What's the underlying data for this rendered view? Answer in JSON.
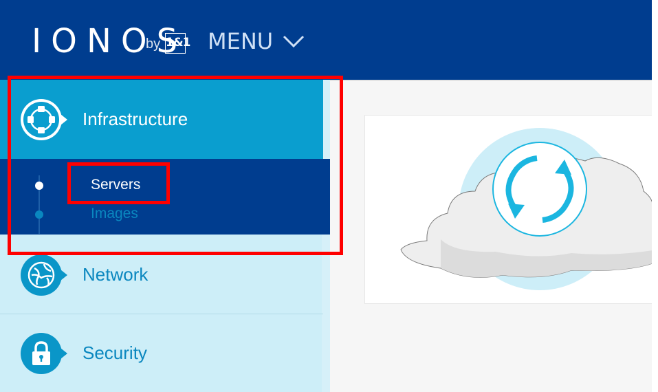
{
  "header": {
    "logo_text": "IONOS",
    "logo_by": "by",
    "logo_brand": "1&1",
    "menu_label": "MENU"
  },
  "sidebar": {
    "items": [
      {
        "label": "Infrastructure",
        "icon": "infrastructure-icon",
        "active": true
      },
      {
        "label": "Network",
        "icon": "globe-icon",
        "active": false
      },
      {
        "label": "Security",
        "icon": "lock-icon",
        "active": false
      }
    ],
    "subitems": [
      {
        "label": "Servers",
        "active": true
      },
      {
        "label": "Images",
        "active": false
      }
    ]
  },
  "content": {
    "illustration": "cloud-sync-icon"
  },
  "colors": {
    "header_bg": "#003d8f",
    "active_item_bg": "#0a9ecf",
    "sidebar_bg": "#cdeef8",
    "accent": "#1bb6e0",
    "highlight": "#ff0000"
  }
}
